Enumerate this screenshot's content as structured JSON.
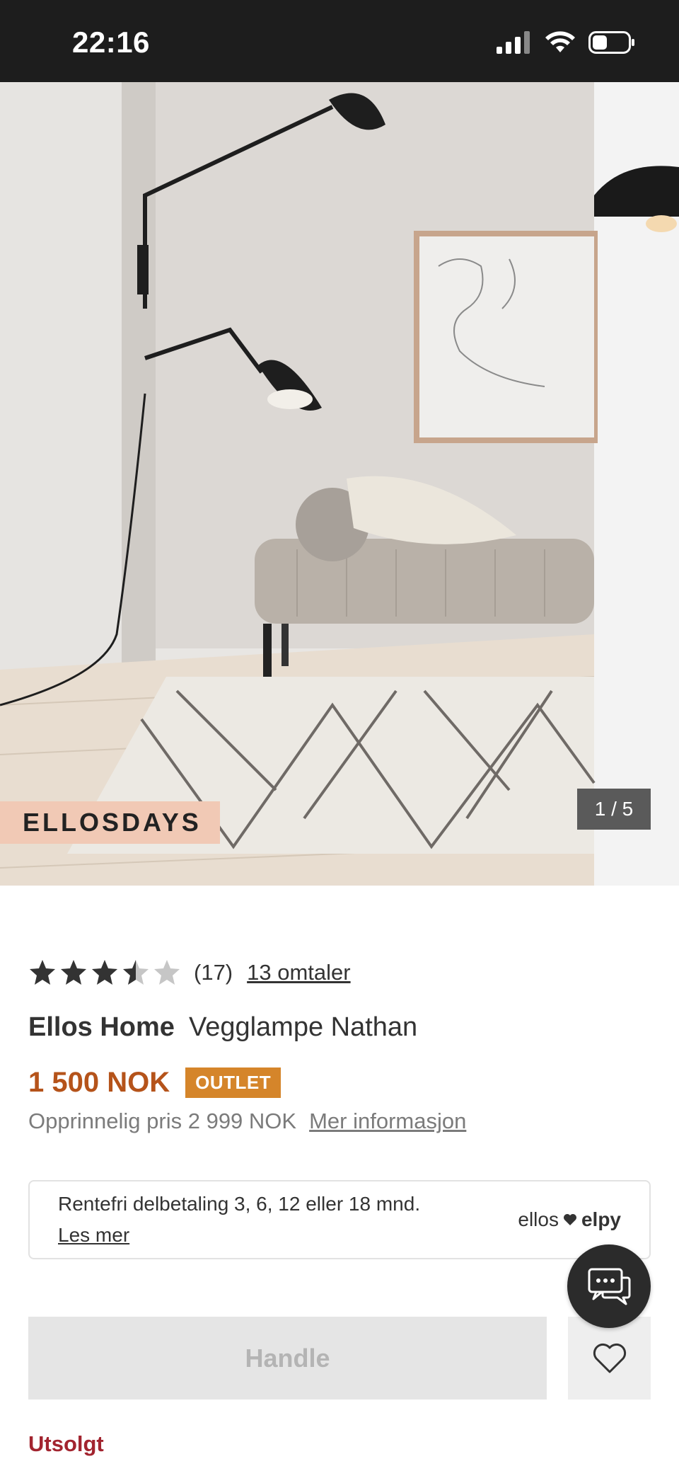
{
  "status_bar": {
    "time": "22:16",
    "icons": [
      "signal-icon",
      "wifi-icon",
      "battery-icon"
    ]
  },
  "gallery": {
    "promo_badge": "ELLOSDAYS",
    "counter": "1 / 5"
  },
  "product": {
    "rating": {
      "value": 3.5,
      "max": 5,
      "count_text": "(17)",
      "reviews_link": "13 omtaler"
    },
    "brand": "Ellos Home",
    "name": "Vegglampe Nathan",
    "price": "1 500 NOK",
    "badge": "OUTLET",
    "original_price": "Opprinnelig pris 2 999 NOK",
    "more_info_link": "Mer informasjon"
  },
  "finance": {
    "text": "Rentefri delbetaling 3, 6, 12 eller 18 mnd.",
    "link": "Les mer",
    "logo_left": "ellos",
    "logo_right": "elpy"
  },
  "actions": {
    "buy_label": "Handle",
    "wishlist_icon": "heart-icon",
    "chat_icon": "chat-icon"
  },
  "stock_status": "Utsolgt",
  "colors": {
    "price": "#b5531a",
    "outlet": "#d5852a",
    "promo": "#f1c9b5",
    "stock": "#a2242f"
  }
}
